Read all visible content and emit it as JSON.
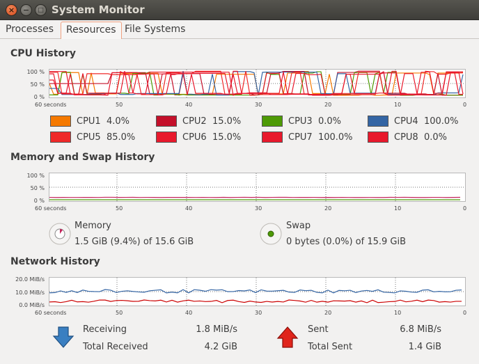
{
  "window": {
    "title": "System Monitor"
  },
  "tabs": [
    {
      "label": "Processes"
    },
    {
      "label": "Resources"
    },
    {
      "label": "File Systems"
    }
  ],
  "cpu": {
    "title": "CPU History",
    "y_ticks": [
      "100 %",
      "50 %",
      "0 %"
    ],
    "x_ticks": [
      "60 seconds",
      "50",
      "40",
      "30",
      "20",
      "10",
      "0"
    ],
    "cores": [
      {
        "name": "CPU1",
        "value": "4.0%",
        "color": "#f57900"
      },
      {
        "name": "CPU2",
        "value": "15.0%",
        "color": "#c4102a"
      },
      {
        "name": "CPU3",
        "value": "0.0%",
        "color": "#4e9a06"
      },
      {
        "name": "CPU4",
        "value": "100.0%",
        "color": "#3465a4"
      },
      {
        "name": "CPU5",
        "value": "85.0%",
        "color": "#ef2929"
      },
      {
        "name": "CPU6",
        "value": "15.0%",
        "color": "#e8192c"
      },
      {
        "name": "CPU7",
        "value": "100.0%",
        "color": "#e8192c"
      },
      {
        "name": "CPU8",
        "value": "0.0%",
        "color": "#e8192c"
      }
    ]
  },
  "memory": {
    "title": "Memory and Swap History",
    "y_ticks": [
      "100 %",
      "50 %",
      "0 %"
    ],
    "x_ticks": [
      "60 seconds",
      "50",
      "40",
      "30",
      "20",
      "10",
      "0"
    ],
    "memory_label": "Memory",
    "memory_value": "1.5 GiB (9.4%) of 15.6 GiB",
    "memory_color": "#c4235b",
    "swap_label": "Swap",
    "swap_value": "0 bytes (0.0%) of 15.9 GiB",
    "swap_color": "#4e9a06"
  },
  "network": {
    "title": "Network History",
    "y_ticks": [
      "20.0 MiB/s",
      "10.0 MiB/s",
      "0.0 MiB/s"
    ],
    "x_ticks": [
      "60 seconds",
      "50",
      "40",
      "30",
      "20",
      "10",
      "0"
    ],
    "receiving_label": "Receiving",
    "receiving_value": "1.8 MiB/s",
    "total_received_label": "Total Received",
    "total_received_value": "4.2 GiB",
    "sent_label": "Sent",
    "sent_value": "6.8 MiB/s",
    "total_sent_label": "Total Sent",
    "total_sent_value": "1.4 GiB",
    "receiving_color": "#3465a4",
    "sent_color": "#cc0000"
  }
}
